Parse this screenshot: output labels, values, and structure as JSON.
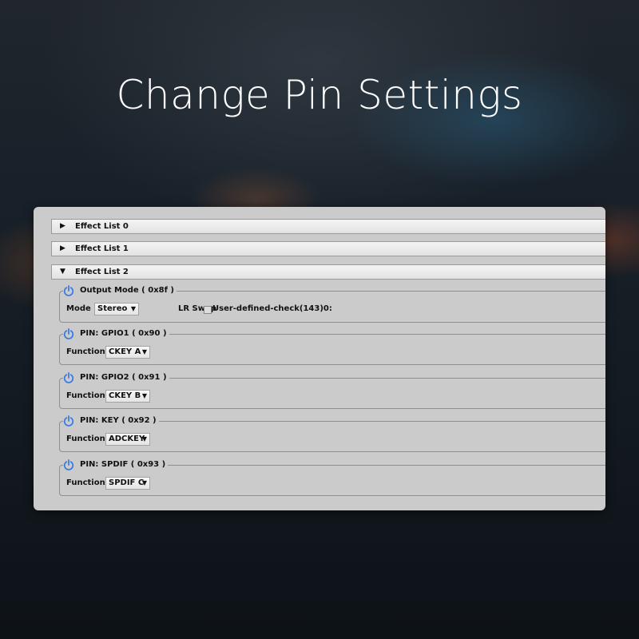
{
  "headline": "Change Pin Settings",
  "effect_lists": [
    {
      "label": "Effect List 0",
      "expanded": false
    },
    {
      "label": "Effect List 1",
      "expanded": false
    },
    {
      "label": "Effect List 2",
      "expanded": true
    }
  ],
  "icons": {
    "collapsed": "triangle-right-icon",
    "expanded": "triangle-down-icon",
    "power": "power-icon"
  },
  "colors": {
    "power_icon": "#3a7be0",
    "panel": "#cbcbcb"
  },
  "output_mode": {
    "title": "Output Mode ( 0x8f )",
    "mode_label": "Mode",
    "mode_value": "Stereo",
    "lr_swap_label": "LR Swap",
    "lr_swap_checked": false,
    "user_defined_label": "User-defined-check(143)0:"
  },
  "pins": [
    {
      "title": "PIN: GPIO1 ( 0x90 )",
      "function_label": "Function",
      "function_value": "CKEY A"
    },
    {
      "title": "PIN: GPIO2 ( 0x91 )",
      "function_label": "Function",
      "function_value": "CKEY B"
    },
    {
      "title": "PIN: KEY ( 0x92 )",
      "function_label": "Function",
      "function_value": "ADCKEY"
    },
    {
      "title": "PIN: SPDIF ( 0x93 )",
      "function_label": "Function",
      "function_value": "SPDIF C"
    }
  ]
}
